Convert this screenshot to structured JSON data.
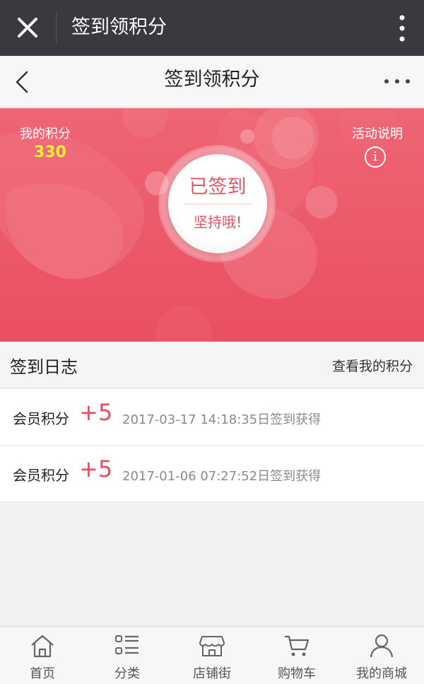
{
  "wechat_bar": {
    "title": "签到领积分"
  },
  "nav": {
    "title": "签到领积分"
  },
  "banner": {
    "my_points_label": "我的积分",
    "my_points_value": "330",
    "rules_label": "活动说明",
    "rules_icon_glyph": "i",
    "sign_status": "已签到",
    "sign_subtext": "坚持哦!",
    "background_color": "#ec5b6b",
    "points_color": "#fff236"
  },
  "log": {
    "title": "签到日志",
    "view_points_link": "查看我的积分",
    "entries": [
      {
        "label": "会员积分",
        "points": "+5",
        "description": "2017-03-17 14:18:35日签到获得"
      },
      {
        "label": "会员积分",
        "points": "+5",
        "description": "2017-01-06 07:27:52日签到获得"
      }
    ]
  },
  "tabs": [
    {
      "label": "首页",
      "icon": "home-icon"
    },
    {
      "label": "分类",
      "icon": "list-icon"
    },
    {
      "label": "店铺街",
      "icon": "store-icon"
    },
    {
      "label": "购物车",
      "icon": "cart-icon"
    },
    {
      "label": "我的商城",
      "icon": "user-icon"
    }
  ]
}
